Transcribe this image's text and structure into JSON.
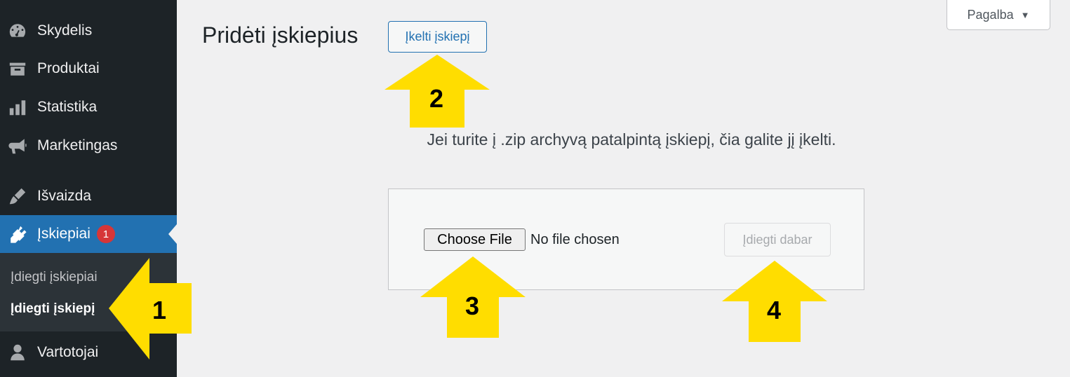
{
  "sidebar": {
    "items": [
      {
        "label": "Skydelis",
        "icon": "dashboard-icon"
      },
      {
        "label": "Produktai",
        "icon": "archive-icon"
      },
      {
        "label": "Statistika",
        "icon": "chart-bar-icon"
      },
      {
        "label": "Marketingas",
        "icon": "megaphone-icon"
      },
      {
        "label": "Išvaizda",
        "icon": "paintbrush-icon"
      },
      {
        "label": "Įskiepiai",
        "icon": "plugin-icon",
        "badge": "1",
        "active": true
      },
      {
        "label": "Vartotojai",
        "icon": "user-icon"
      }
    ],
    "submenu": [
      {
        "label": "Įdiegti įskiepiai"
      },
      {
        "label": "Įdiegti įskiepį",
        "current": true
      }
    ]
  },
  "header": {
    "title": "Pridėti įskiepius",
    "upload_button": "Įkelti įskiepį",
    "help_button": "Pagalba",
    "help_caret": "▼"
  },
  "upload": {
    "help_text": "Jei turite į .zip archyvą patalpintą įskiepį, čia galite jį įkelti.",
    "choose_file_label": "Choose File",
    "no_file_text": "No file chosen",
    "install_button": "Įdiegti dabar"
  },
  "annotations": {
    "arrow1": "1",
    "arrow2": "2",
    "arrow3": "3",
    "arrow4": "4",
    "color": "#ffdd00"
  },
  "colors": {
    "sidebar_bg": "#1d2327",
    "active_bg": "#2271b1",
    "badge": "#d63638",
    "page_bg": "#f0f0f1"
  }
}
